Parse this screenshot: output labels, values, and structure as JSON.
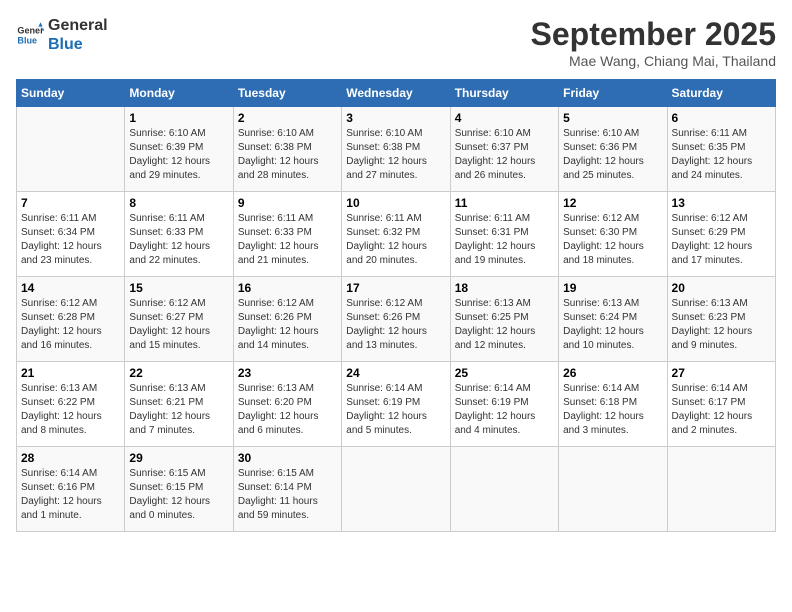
{
  "logo": {
    "line1": "General",
    "line2": "Blue"
  },
  "title": "September 2025",
  "location": "Mae Wang, Chiang Mai, Thailand",
  "days_of_week": [
    "Sunday",
    "Monday",
    "Tuesday",
    "Wednesday",
    "Thursday",
    "Friday",
    "Saturday"
  ],
  "weeks": [
    [
      {
        "day": "",
        "info": ""
      },
      {
        "day": "1",
        "info": "Sunrise: 6:10 AM\nSunset: 6:39 PM\nDaylight: 12 hours\nand 29 minutes."
      },
      {
        "day": "2",
        "info": "Sunrise: 6:10 AM\nSunset: 6:38 PM\nDaylight: 12 hours\nand 28 minutes."
      },
      {
        "day": "3",
        "info": "Sunrise: 6:10 AM\nSunset: 6:38 PM\nDaylight: 12 hours\nand 27 minutes."
      },
      {
        "day": "4",
        "info": "Sunrise: 6:10 AM\nSunset: 6:37 PM\nDaylight: 12 hours\nand 26 minutes."
      },
      {
        "day": "5",
        "info": "Sunrise: 6:10 AM\nSunset: 6:36 PM\nDaylight: 12 hours\nand 25 minutes."
      },
      {
        "day": "6",
        "info": "Sunrise: 6:11 AM\nSunset: 6:35 PM\nDaylight: 12 hours\nand 24 minutes."
      }
    ],
    [
      {
        "day": "7",
        "info": "Sunrise: 6:11 AM\nSunset: 6:34 PM\nDaylight: 12 hours\nand 23 minutes."
      },
      {
        "day": "8",
        "info": "Sunrise: 6:11 AM\nSunset: 6:33 PM\nDaylight: 12 hours\nand 22 minutes."
      },
      {
        "day": "9",
        "info": "Sunrise: 6:11 AM\nSunset: 6:33 PM\nDaylight: 12 hours\nand 21 minutes."
      },
      {
        "day": "10",
        "info": "Sunrise: 6:11 AM\nSunset: 6:32 PM\nDaylight: 12 hours\nand 20 minutes."
      },
      {
        "day": "11",
        "info": "Sunrise: 6:11 AM\nSunset: 6:31 PM\nDaylight: 12 hours\nand 19 minutes."
      },
      {
        "day": "12",
        "info": "Sunrise: 6:12 AM\nSunset: 6:30 PM\nDaylight: 12 hours\nand 18 minutes."
      },
      {
        "day": "13",
        "info": "Sunrise: 6:12 AM\nSunset: 6:29 PM\nDaylight: 12 hours\nand 17 minutes."
      }
    ],
    [
      {
        "day": "14",
        "info": "Sunrise: 6:12 AM\nSunset: 6:28 PM\nDaylight: 12 hours\nand 16 minutes."
      },
      {
        "day": "15",
        "info": "Sunrise: 6:12 AM\nSunset: 6:27 PM\nDaylight: 12 hours\nand 15 minutes."
      },
      {
        "day": "16",
        "info": "Sunrise: 6:12 AM\nSunset: 6:26 PM\nDaylight: 12 hours\nand 14 minutes."
      },
      {
        "day": "17",
        "info": "Sunrise: 6:12 AM\nSunset: 6:26 PM\nDaylight: 12 hours\nand 13 minutes."
      },
      {
        "day": "18",
        "info": "Sunrise: 6:13 AM\nSunset: 6:25 PM\nDaylight: 12 hours\nand 12 minutes."
      },
      {
        "day": "19",
        "info": "Sunrise: 6:13 AM\nSunset: 6:24 PM\nDaylight: 12 hours\nand 10 minutes."
      },
      {
        "day": "20",
        "info": "Sunrise: 6:13 AM\nSunset: 6:23 PM\nDaylight: 12 hours\nand 9 minutes."
      }
    ],
    [
      {
        "day": "21",
        "info": "Sunrise: 6:13 AM\nSunset: 6:22 PM\nDaylight: 12 hours\nand 8 minutes."
      },
      {
        "day": "22",
        "info": "Sunrise: 6:13 AM\nSunset: 6:21 PM\nDaylight: 12 hours\nand 7 minutes."
      },
      {
        "day": "23",
        "info": "Sunrise: 6:13 AM\nSunset: 6:20 PM\nDaylight: 12 hours\nand 6 minutes."
      },
      {
        "day": "24",
        "info": "Sunrise: 6:14 AM\nSunset: 6:19 PM\nDaylight: 12 hours\nand 5 minutes."
      },
      {
        "day": "25",
        "info": "Sunrise: 6:14 AM\nSunset: 6:19 PM\nDaylight: 12 hours\nand 4 minutes."
      },
      {
        "day": "26",
        "info": "Sunrise: 6:14 AM\nSunset: 6:18 PM\nDaylight: 12 hours\nand 3 minutes."
      },
      {
        "day": "27",
        "info": "Sunrise: 6:14 AM\nSunset: 6:17 PM\nDaylight: 12 hours\nand 2 minutes."
      }
    ],
    [
      {
        "day": "28",
        "info": "Sunrise: 6:14 AM\nSunset: 6:16 PM\nDaylight: 12 hours\nand 1 minute."
      },
      {
        "day": "29",
        "info": "Sunrise: 6:15 AM\nSunset: 6:15 PM\nDaylight: 12 hours\nand 0 minutes."
      },
      {
        "day": "30",
        "info": "Sunrise: 6:15 AM\nSunset: 6:14 PM\nDaylight: 11 hours\nand 59 minutes."
      },
      {
        "day": "",
        "info": ""
      },
      {
        "day": "",
        "info": ""
      },
      {
        "day": "",
        "info": ""
      },
      {
        "day": "",
        "info": ""
      }
    ]
  ]
}
